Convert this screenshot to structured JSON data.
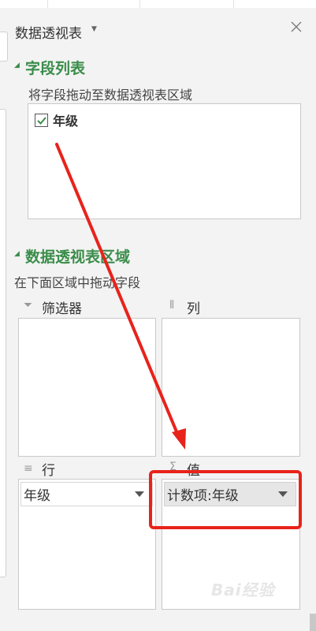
{
  "panel": {
    "title": "数据透视表"
  },
  "field_list": {
    "heading": "字段列表",
    "hint": "将字段拖动至数据透视表区域",
    "fields": [
      {
        "label": "年级",
        "checked": true
      }
    ]
  },
  "pivot_areas": {
    "heading": "数据透视表区域",
    "hint": "在下面区域中拖动字段",
    "filter": {
      "label": "筛选器",
      "icon": "funnel-icon"
    },
    "columns": {
      "label": "列",
      "icon": "columns-icon"
    },
    "rows": {
      "label": "行",
      "icon": "rows-icon",
      "item": "年级"
    },
    "values": {
      "label": "值",
      "icon": "sigma-icon",
      "item": "计数项:年级"
    }
  },
  "annotation": {
    "arrow_color": "#e8231b",
    "highlight_color": "#e8231b"
  },
  "colors": {
    "accent": "#3a8d4a",
    "panel_bg": "#f3f3f3",
    "selected_item_bg": "#e6e6e6"
  }
}
